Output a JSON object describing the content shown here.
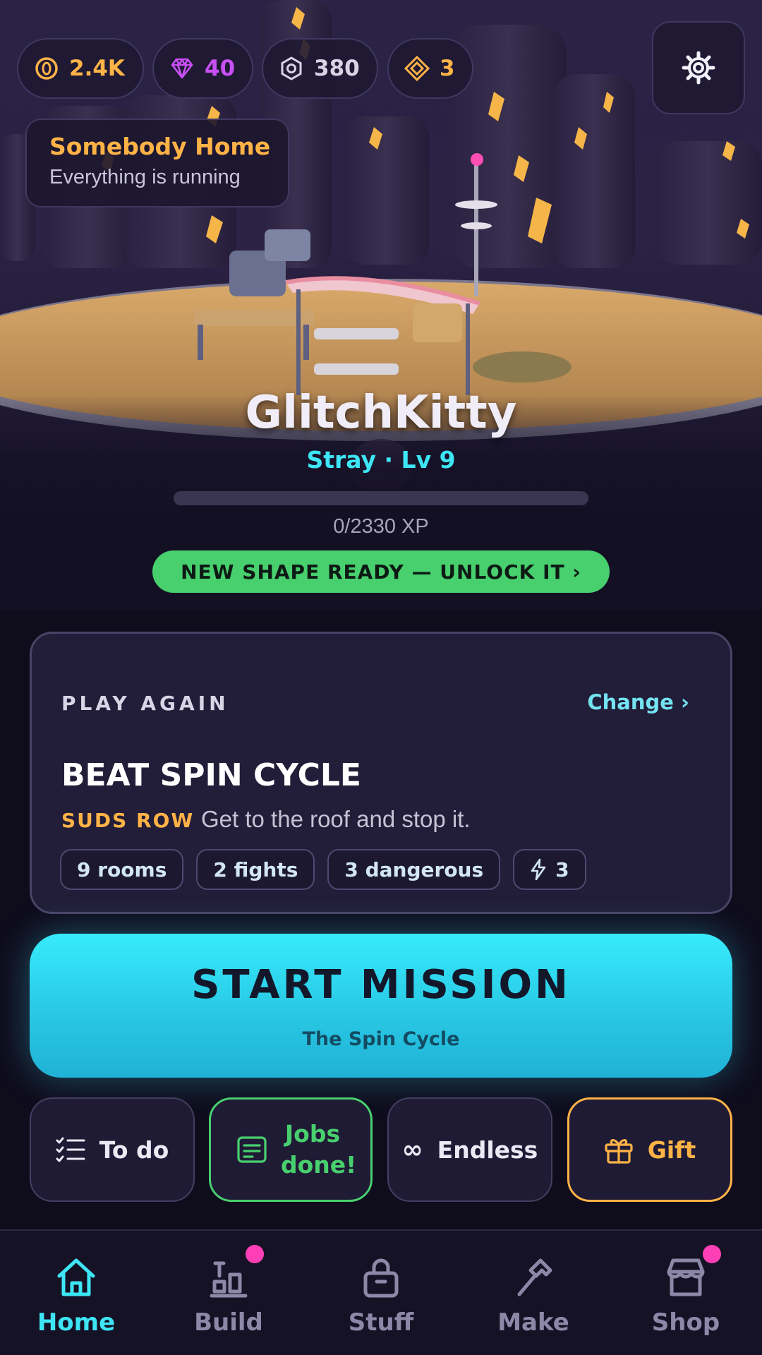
{
  "currencies": {
    "coins": {
      "icon": "coin-icon",
      "value": "2.4K",
      "color": "#ffb347"
    },
    "gems": {
      "icon": "gem-icon",
      "value": "40",
      "color": "#c850f5"
    },
    "gears": {
      "icon": "gear-part-icon",
      "value": "380",
      "color": "#d8d4e6"
    },
    "tokens": {
      "icon": "diamond-token-icon",
      "value": "3",
      "color": "#ffb347"
    }
  },
  "settings": {
    "icon": "gear-icon"
  },
  "status": {
    "title": "Somebody Home",
    "subtitle": "Everything is running"
  },
  "pet": {
    "name": "GlitchKitty",
    "class_level": "Stray · Lv 9",
    "xp_text": "0/2330 XP",
    "xp_progress": 0.0
  },
  "unlock_banner": "NEW SHAPE READY — UNLOCK IT ›",
  "mission": {
    "section_label": "PLAY AGAIN",
    "change_label": "Change ›",
    "title": "BEAT SPIN CYCLE",
    "location": "SUDS ROW",
    "description": "Get to the roof and stop it.",
    "tags": [
      "9 rooms",
      "2 fights",
      "3 dangerous",
      "3"
    ],
    "energy_icon": "lightning-icon"
  },
  "start": {
    "label": "START MISSION",
    "subtitle": "The Spin Cycle"
  },
  "quick_actions": {
    "todo": "To do",
    "jobs": "Jobs done!",
    "endless": "Endless",
    "endless_glyph": "∞",
    "gift": "Gift"
  },
  "nav": {
    "items": [
      {
        "label": "Home",
        "icon": "home-icon",
        "active": true,
        "badge": false
      },
      {
        "label": "Build",
        "icon": "build-icon",
        "active": false,
        "badge": true
      },
      {
        "label": "Stuff",
        "icon": "bag-icon",
        "active": false,
        "badge": false
      },
      {
        "label": "Make",
        "icon": "hammer-icon",
        "active": false,
        "badge": false
      },
      {
        "label": "Shop",
        "icon": "shop-icon",
        "active": false,
        "badge": true
      }
    ]
  },
  "colors": {
    "accent": "#3ee6f5",
    "gold": "#ffb347",
    "green": "#48cf6e",
    "badge": "#ff3fb5"
  }
}
